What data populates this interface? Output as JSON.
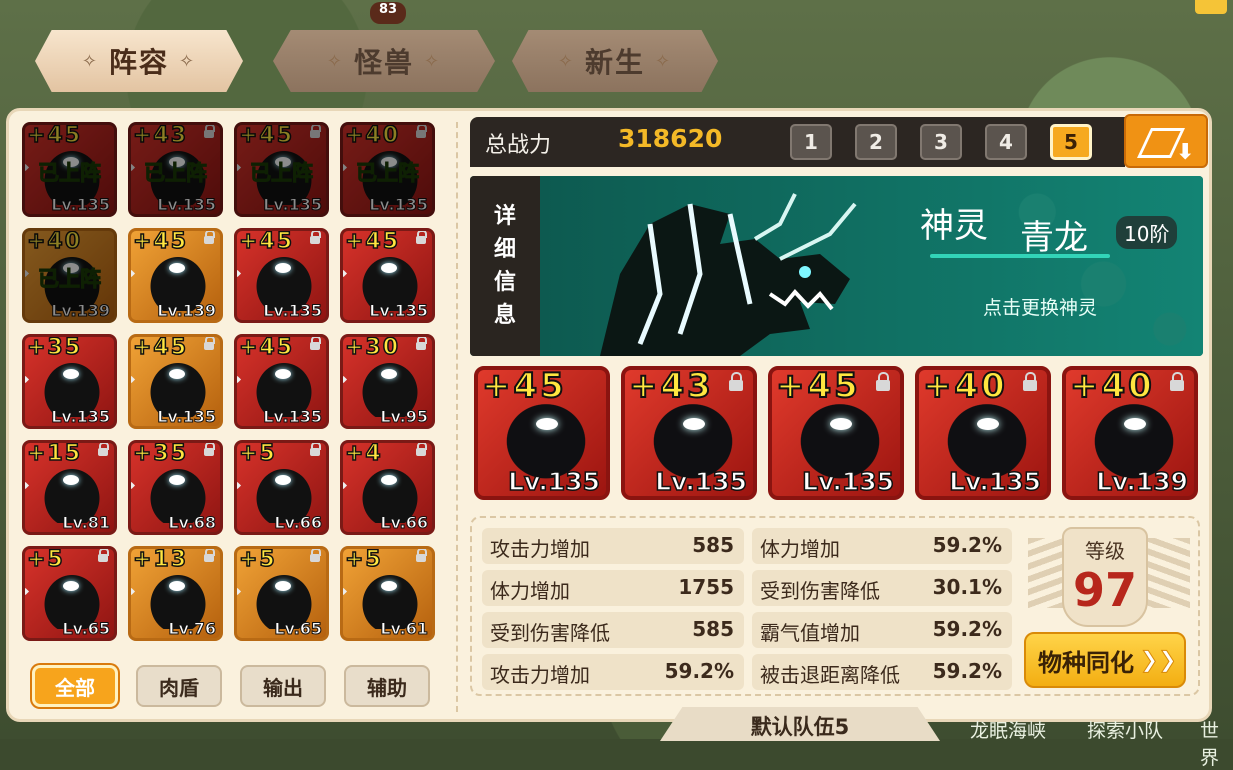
{
  "top_badge": "83",
  "tabs": [
    {
      "label": "阵容",
      "active": true
    },
    {
      "label": "怪兽",
      "active": false
    },
    {
      "label": "新生",
      "active": false
    }
  ],
  "tab_deco": "✧",
  "grid_cards": [
    {
      "plus": "+45",
      "lv": "Lv.135",
      "on_team": "已上阵",
      "lock": false,
      "style": "red",
      "dim": true
    },
    {
      "plus": "+43",
      "lv": "Lv.135",
      "on_team": "已上阵",
      "lock": true,
      "style": "red",
      "dim": true
    },
    {
      "plus": "+45",
      "lv": "Lv.135",
      "on_team": "已上阵",
      "lock": true,
      "style": "red",
      "dim": true
    },
    {
      "plus": "+40",
      "lv": "Lv.135",
      "on_team": "已上阵",
      "lock": true,
      "style": "red",
      "dim": true
    },
    {
      "plus": "+40",
      "lv": "Lv.139",
      "on_team": "已上阵",
      "lock": false,
      "style": "gold",
      "dim": true
    },
    {
      "plus": "+45",
      "lv": "Lv.139",
      "on_team": "",
      "lock": true,
      "style": "gold",
      "dim": false
    },
    {
      "plus": "+45",
      "lv": "Lv.135",
      "on_team": "",
      "lock": true,
      "style": "red",
      "dim": false
    },
    {
      "plus": "+45",
      "lv": "Lv.135",
      "on_team": "",
      "lock": true,
      "style": "red",
      "dim": false
    },
    {
      "plus": "+35",
      "lv": "Lv.135",
      "on_team": "",
      "lock": false,
      "style": "red",
      "dim": false
    },
    {
      "plus": "+45",
      "lv": "Lv.135",
      "on_team": "",
      "lock": true,
      "style": "gold",
      "dim": false
    },
    {
      "plus": "+45",
      "lv": "Lv.135",
      "on_team": "",
      "lock": true,
      "style": "red",
      "dim": false
    },
    {
      "plus": "+30",
      "lv": "Lv.95",
      "on_team": "",
      "lock": true,
      "style": "red",
      "dim": false
    },
    {
      "plus": "+15",
      "lv": "Lv.81",
      "on_team": "",
      "lock": true,
      "style": "red",
      "dim": false
    },
    {
      "plus": "+35",
      "lv": "Lv.68",
      "on_team": "",
      "lock": true,
      "style": "red",
      "dim": false
    },
    {
      "plus": "+5",
      "lv": "Lv.66",
      "on_team": "",
      "lock": true,
      "style": "red",
      "dim": false
    },
    {
      "plus": "+4",
      "lv": "Lv.66",
      "on_team": "",
      "lock": true,
      "style": "red",
      "dim": false
    },
    {
      "plus": "+5",
      "lv": "Lv.65",
      "on_team": "",
      "lock": true,
      "style": "red",
      "dim": false
    },
    {
      "plus": "+13",
      "lv": "Lv.76",
      "on_team": "",
      "lock": true,
      "style": "gold",
      "dim": false
    },
    {
      "plus": "+5",
      "lv": "Lv.65",
      "on_team": "",
      "lock": true,
      "style": "gold",
      "dim": false
    },
    {
      "plus": "+5",
      "lv": "Lv.61",
      "on_team": "",
      "lock": true,
      "style": "gold",
      "dim": false
    }
  ],
  "filters": [
    {
      "label": "全部",
      "active": true
    },
    {
      "label": "肉盾",
      "active": false
    },
    {
      "label": "输出",
      "active": false
    },
    {
      "label": "辅助",
      "active": false
    }
  ],
  "power": {
    "label": "总战力",
    "value": "318620"
  },
  "team_tabs": [
    {
      "label": "1",
      "active": false
    },
    {
      "label": "2",
      "active": false
    },
    {
      "label": "3",
      "active": false
    },
    {
      "label": "4",
      "active": false
    },
    {
      "label": "5",
      "active": true
    }
  ],
  "spirit": {
    "side_chars": [
      "详",
      "细",
      "信",
      "息"
    ],
    "kind": "神灵",
    "name": "青龙",
    "rank": "10阶",
    "hint": "点击更换神灵"
  },
  "team_cards": [
    {
      "plus": "+45",
      "lv": "Lv.135",
      "lock": false
    },
    {
      "plus": "+43",
      "lv": "Lv.135",
      "lock": true
    },
    {
      "plus": "+45",
      "lv": "Lv.135",
      "lock": true
    },
    {
      "plus": "+40",
      "lv": "Lv.135",
      "lock": true
    },
    {
      "plus": "+40",
      "lv": "Lv.139",
      "lock": true
    }
  ],
  "stats_left": [
    {
      "k": "攻击力增加",
      "v": "585"
    },
    {
      "k": "体力增加",
      "v": "1755"
    },
    {
      "k": "受到伤害降低",
      "v": "585"
    },
    {
      "k": "攻击力增加",
      "v": "59.2%"
    }
  ],
  "stats_right": [
    {
      "k": "体力增加",
      "v": "59.2%"
    },
    {
      "k": "受到伤害降低",
      "v": "30.1%"
    },
    {
      "k": "霸气值增加",
      "v": "59.2%"
    },
    {
      "k": "被击退距离降低",
      "v": "59.2%"
    }
  ],
  "level": {
    "label": "等级",
    "value": "97"
  },
  "assimilate": {
    "label": "物种同化",
    "chevron": "❯❯"
  },
  "default_team": "默认队伍5",
  "map_labels": [
    "龙眠海峡",
    "探索小队",
    "世界"
  ]
}
